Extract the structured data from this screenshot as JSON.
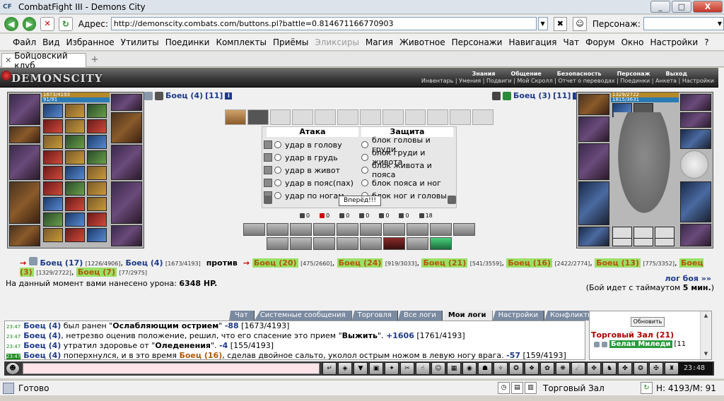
{
  "window": {
    "title": "CombatFight III - Demons City",
    "app_icon": "CF",
    "buttons": [
      "_",
      "□",
      "X"
    ]
  },
  "address_bar": {
    "label": "Адрес:",
    "url": "http://demonscity.combats.com/buttons.pl?battle=0.814671166770903",
    "person_label": "Персонаж:"
  },
  "menu": [
    "Файл",
    "Вид",
    "Избранное",
    "Утилиты",
    "Поединки",
    "Комплекты",
    "Приёмы",
    "Эликсиры",
    "Магия",
    "Животное",
    "Персонажи",
    "Навигация",
    "Чат",
    "Форум",
    "Окно",
    "Настройки",
    "?"
  ],
  "menu_disabled_index": 7,
  "tab": {
    "label": "Бойцовский клуб"
  },
  "game_header": {
    "logo": "DEMONSCITY",
    "top_links": [
      "Знания",
      "Общение",
      "Безопасность",
      "Персонаж",
      "Выход"
    ],
    "bottom_links": [
      "Инвентарь | Умения | Подвиги | Мой Скролл | Отчет о переводах | Поединки | Анкета | Настройки"
    ]
  },
  "left_player": {
    "name": "Боец (4)",
    "level": "[11]",
    "hp": "1673/4193",
    "mana": "91/91"
  },
  "right_player": {
    "name": "Боец (3)",
    "level": "[11]",
    "hp": "1329/2722",
    "mana": "1815/3631"
  },
  "info_icon": "i",
  "combat": {
    "attack_title": "Атака",
    "defense_title": "Защита",
    "attacks": [
      "удар в голову",
      "удар в грудь",
      "удар в живот",
      "удар в пояс(пах)",
      "удар по ногам"
    ],
    "blocks": [
      "блок головы и груди",
      "блок груди и живота",
      "блок живота и пояса",
      "блок пояса и ног",
      "блок ног и головы"
    ],
    "forward_button": "Вперёд!!!"
  },
  "stats": [
    "0",
    "0",
    "0",
    "0",
    "0",
    "0",
    "18"
  ],
  "versus": {
    "left_team": [
      {
        "name": "Боец (17)",
        "hp": "[1226/4906]"
      },
      {
        "name": "Боец (4)",
        "hp": "[1673/4193]"
      }
    ],
    "vs_word": "против",
    "right_team": [
      {
        "name": "Боец (20)",
        "hp": "[475/2660]"
      },
      {
        "name": "Боец (24)",
        "hp": "[919/3033]"
      },
      {
        "name": "Боец (21)",
        "hp": "[541/3559]"
      },
      {
        "name": "Боец (16)",
        "hp": "[2422/2774]"
      },
      {
        "name": "Боец (13)",
        "hp": "[775/3352]"
      },
      {
        "name": "Боец (3)",
        "hp": "[1329/2722]"
      },
      {
        "name": "Боец (7)",
        "hp": "[77/2975]"
      }
    ]
  },
  "damage": {
    "text": "На данный момент вами нанесено урона:",
    "value": "6348 HP."
  },
  "log_link": "лог боя »»",
  "timeout": {
    "before": "(Бой идет с таймаутом",
    "value": "5 мин.",
    "after": ")"
  },
  "chat_tabs": [
    "Чат",
    "Системные сообщения",
    "Торговля",
    "Все логи",
    "Мои логи",
    "Настройки",
    "Конфликты"
  ],
  "chat_active_tab": 4,
  "chat_messages": [
    {
      "time": "23:47",
      "parts": [
        {
          "t": "Боец (4)",
          "c": "fn"
        },
        {
          "t": " был ранен \""
        },
        {
          "t": "Ослабляющим острием",
          "c": "b"
        },
        {
          "t": "\" "
        },
        {
          "t": "-88",
          "c": "neg"
        },
        {
          "t": " [1673/4193]"
        }
      ]
    },
    {
      "time": "23:47",
      "parts": [
        {
          "t": "Боец (4)",
          "c": "fn"
        },
        {
          "t": ", нетрезво оценив положение, решил, что его спасение это прием \""
        },
        {
          "t": "Выжить",
          "c": "b"
        },
        {
          "t": "\". "
        },
        {
          "t": "+1606",
          "c": "pos"
        },
        {
          "t": " [1761/4193]"
        }
      ]
    },
    {
      "time": "23:47",
      "parts": [
        {
          "t": "Боец (4)",
          "c": "fn"
        },
        {
          "t": " утратил здоровье от \""
        },
        {
          "t": "Оледенения",
          "c": "b"
        },
        {
          "t": "\". "
        },
        {
          "t": "-4",
          "c": "neg"
        },
        {
          "t": " [155/4193]"
        }
      ]
    },
    {
      "time": "23:47",
      "hl": true,
      "parts": [
        {
          "t": "Боец (4)",
          "c": "fn"
        },
        {
          "t": " поперхнулся, и в это время "
        },
        {
          "t": "Боец (16)",
          "c": "fn orange"
        },
        {
          "t": ", сделав двойное сальто, уколол острым ножом в левую ногу врага. "
        },
        {
          "t": "-57",
          "c": "neg"
        },
        {
          "t": " [159/4193]"
        }
      ]
    }
  ],
  "room": {
    "refresh": "Обновить",
    "title": "Торговый Зал (21)",
    "user": "Белая Миледи",
    "user_level": "[11"
  },
  "clock": "23:48",
  "status": {
    "text": "Готово",
    "zone": "Торговый Зал",
    "hm": "H: 4193/M: 91"
  },
  "colors": {
    "accent_blue": "#1d3a8a",
    "highlight_green": "#9be066",
    "hp_gold": "#b4892a",
    "mana_blue": "#2a7ab4"
  }
}
